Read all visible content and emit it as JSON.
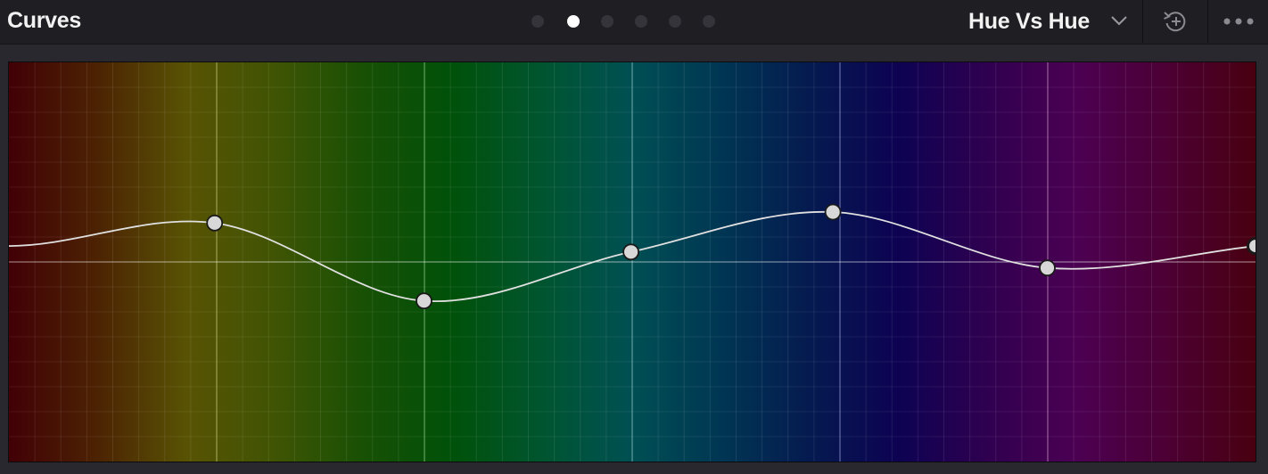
{
  "header": {
    "title": "Curves",
    "page_dots": {
      "count": 6,
      "active_index": 1
    },
    "mode": {
      "selected": "Hue Vs Hue"
    },
    "icons": {
      "mode_dropdown": "chevron-down-icon",
      "reset": "reset-icon",
      "more": "more-options-icon"
    }
  },
  "graph": {
    "curve": "Hue Vs Hue",
    "control_points": [
      {
        "hue": 0.165,
        "value": 0.0437
      },
      {
        "hue": 0.333,
        "value": -0.0437
      },
      {
        "hue": 0.499,
        "value": 0.0112
      },
      {
        "hue": 0.661,
        "value": 0.056
      },
      {
        "hue": 0.833,
        "value": -0.0067
      },
      {
        "hue": 1.0,
        "value": 0.0179
      }
    ],
    "colors": {
      "gradient_stops": [
        "#420006",
        "#4c2303",
        "#585304",
        "#3f5404",
        "#175004",
        "#00510a",
        "#005530",
        "#004f53",
        "#003653",
        "#051a50",
        "#0d0252",
        "#300050",
        "#4c0052",
        "#4c0034",
        "#480010"
      ],
      "curve_line": "#e0e0e0",
      "point_fill": "#d8d8d8",
      "point_stroke": "#1a1a1a",
      "background": "#28282e",
      "header": "#1f1f23"
    }
  }
}
